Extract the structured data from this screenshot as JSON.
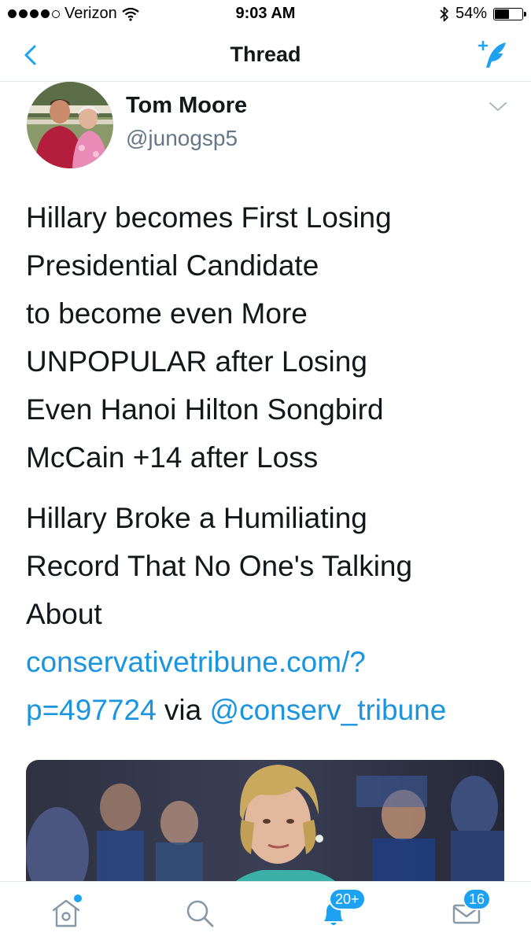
{
  "status_bar": {
    "carrier": "Verizon",
    "time": "9:03 AM",
    "battery_percent": "54%",
    "battery_level": 0.54,
    "signal_bars_filled": 4,
    "signal_bars_total": 5,
    "icons": [
      "wifi-icon",
      "bluetooth-icon",
      "battery-icon"
    ]
  },
  "nav": {
    "title": "Thread",
    "back_icon": "chevron-left-icon",
    "compose_icon": "compose-tweet-icon"
  },
  "tweet": {
    "author_name": "Tom Moore",
    "author_handle": "@junogsp5",
    "menu_icon": "chevron-down-icon",
    "paragraph1": [
      "Hillary becomes First Losing",
      "Presidential Candidate",
      "to become even More",
      "UNPOPULAR after Losing",
      "Even Hanoi Hilton Songbird",
      "McCain +14 after Loss"
    ],
    "paragraph2": [
      "Hillary Broke a Humiliating",
      "Record That No One's Talking",
      "About"
    ],
    "link_line1": "conservativetribune.com/?",
    "link_line2": "p=497724",
    "via_text": " via ",
    "mention": "@conserv_tribune"
  },
  "tab_bar": {
    "tabs": [
      {
        "name": "home",
        "icon": "home-icon",
        "has_dot": true
      },
      {
        "name": "search",
        "icon": "search-icon"
      },
      {
        "name": "notifications",
        "icon": "bell-icon",
        "badge": "20+"
      },
      {
        "name": "messages",
        "icon": "envelope-icon",
        "badge": "16"
      }
    ]
  },
  "colors": {
    "accent": "#1da1f2",
    "link": "#1b95e0",
    "text": "#14171a",
    "secondary_text": "#657786",
    "divider": "#e1e8ed"
  }
}
